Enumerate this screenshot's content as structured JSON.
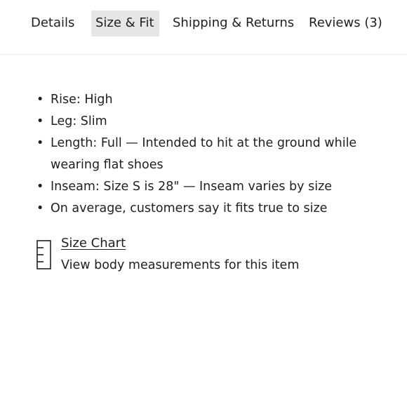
{
  "tabs": [
    {
      "label": "Details",
      "selected": false
    },
    {
      "label": "Size & Fit",
      "selected": true
    },
    {
      "label": "Shipping & Returns",
      "selected": false
    },
    {
      "label": "Reviews (3)",
      "selected": false
    }
  ],
  "fit_details": [
    "Rise: High",
    "Leg: Slim",
    "Length: Full — Intended to hit at the ground while wearing flat shoes",
    "Inseam: Size S is 28\" — Inseam varies by size",
    "On average, customers say it fits true to size"
  ],
  "size_chart": {
    "icon": "ruler-icon",
    "link_label": "Size Chart",
    "description": "View body measurements for this item"
  },
  "colors": {
    "text": "#1f1f1f",
    "selected_tab_bg": "#e6e6e6",
    "divider": "#ececec"
  }
}
